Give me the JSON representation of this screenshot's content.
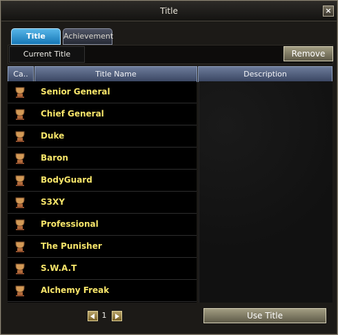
{
  "window": {
    "title": "Title"
  },
  "tabs": [
    {
      "label": "Title",
      "active": true
    },
    {
      "label": "Achievement",
      "active": false
    }
  ],
  "toolbar": {
    "current_title_label": "Current Title",
    "remove_label": "Remove"
  },
  "table": {
    "headers": {
      "category": "Ca..",
      "name": "Title Name",
      "description": "Description"
    },
    "rows": [
      {
        "icon": "trophy-icon",
        "label": "Senior General"
      },
      {
        "icon": "trophy-icon",
        "label": "Chief General"
      },
      {
        "icon": "trophy-icon",
        "label": "Duke"
      },
      {
        "icon": "trophy-icon",
        "label": "Baron"
      },
      {
        "icon": "trophy-icon",
        "label": "BodyGuard"
      },
      {
        "icon": "trophy-icon",
        "label": "S3XY"
      },
      {
        "icon": "trophy-icon",
        "label": "Professional"
      },
      {
        "icon": "trophy-icon",
        "label": "The Punisher"
      },
      {
        "icon": "trophy-icon",
        "label": "S.W.A.T"
      },
      {
        "icon": "trophy-icon",
        "label": "Alchemy Freak"
      }
    ]
  },
  "pager": {
    "page": "1"
  },
  "footer": {
    "use_title_label": "Use Title"
  },
  "colors": {
    "accent": "#1577b6",
    "title_text": "#f7e56a"
  }
}
